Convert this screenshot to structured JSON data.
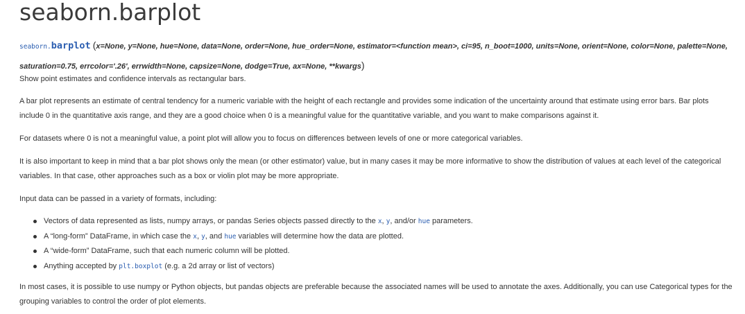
{
  "title": "seaborn.barplot",
  "signature": {
    "module": "seaborn.",
    "function": "barplot",
    "open_paren": "(",
    "params_line1": "x=None, y=None, hue=None, data=None, order=None, hue_order=None, estimator=<function mean>, ci=95, n_boot=1000, units=None, orient=None, color=None,",
    "params_line2": "palette=None, saturation=0.75, errcolor='.26', errwidth=None, capsize=None, dodge=True, ax=None, **kwargs",
    "close_paren": ")"
  },
  "summary": "Show point estimates and confidence intervals as rectangular bars.",
  "para1": "A bar plot represents an estimate of central tendency for a numeric variable with the height of each rectangle and provides some indication of the uncertainty around that estimate using error bars. Bar plots include 0 in the quantitative axis range, and they are a good choice when 0 is a meaningful value for the quantitative variable, and you want to make comparisons against it.",
  "para2": "For datasets where 0 is not a meaningful value, a point plot will allow you to focus on differences between levels of one or more categorical variables.",
  "para3": "It is also important to keep in mind that a bar plot shows only the mean (or other estimator) value, but in many cases it may be more informative to show the distribution of values at each level of the categorical variables. In that case, other approaches such as a box or violin plot may be more appropriate.",
  "para4": "Input data can be passed in a variety of formats, including:",
  "bullets": {
    "b1": {
      "pre": "Vectors of data represented as lists, numpy arrays, or pandas Series objects passed directly to the ",
      "code_x": "x",
      "sep1": ", ",
      "code_y": "y",
      "mid": ", and/or ",
      "code_hue": "hue",
      "post": " parameters."
    },
    "b2": {
      "pre": "A “long-form” DataFrame, in which case the ",
      "code_x": "x",
      "sep1": ", ",
      "code_y": "y",
      "mid": ", and ",
      "code_hue": "hue",
      "post": " variables will determine how the data are plotted."
    },
    "b3": {
      "text": "A “wide-form” DataFrame, such that each numeric column will be plotted."
    },
    "b4": {
      "pre": "Anything accepted by ",
      "code": "plt.boxplot",
      "post": " (e.g. a 2d array or list of vectors)"
    }
  },
  "para5": "In most cases, it is possible to use numpy or Python objects, but pandas objects are preferable because the associated names will be used to annotate the axes. Additionally, you can use Categorical types for the grouping variables to control the order of plot elements."
}
